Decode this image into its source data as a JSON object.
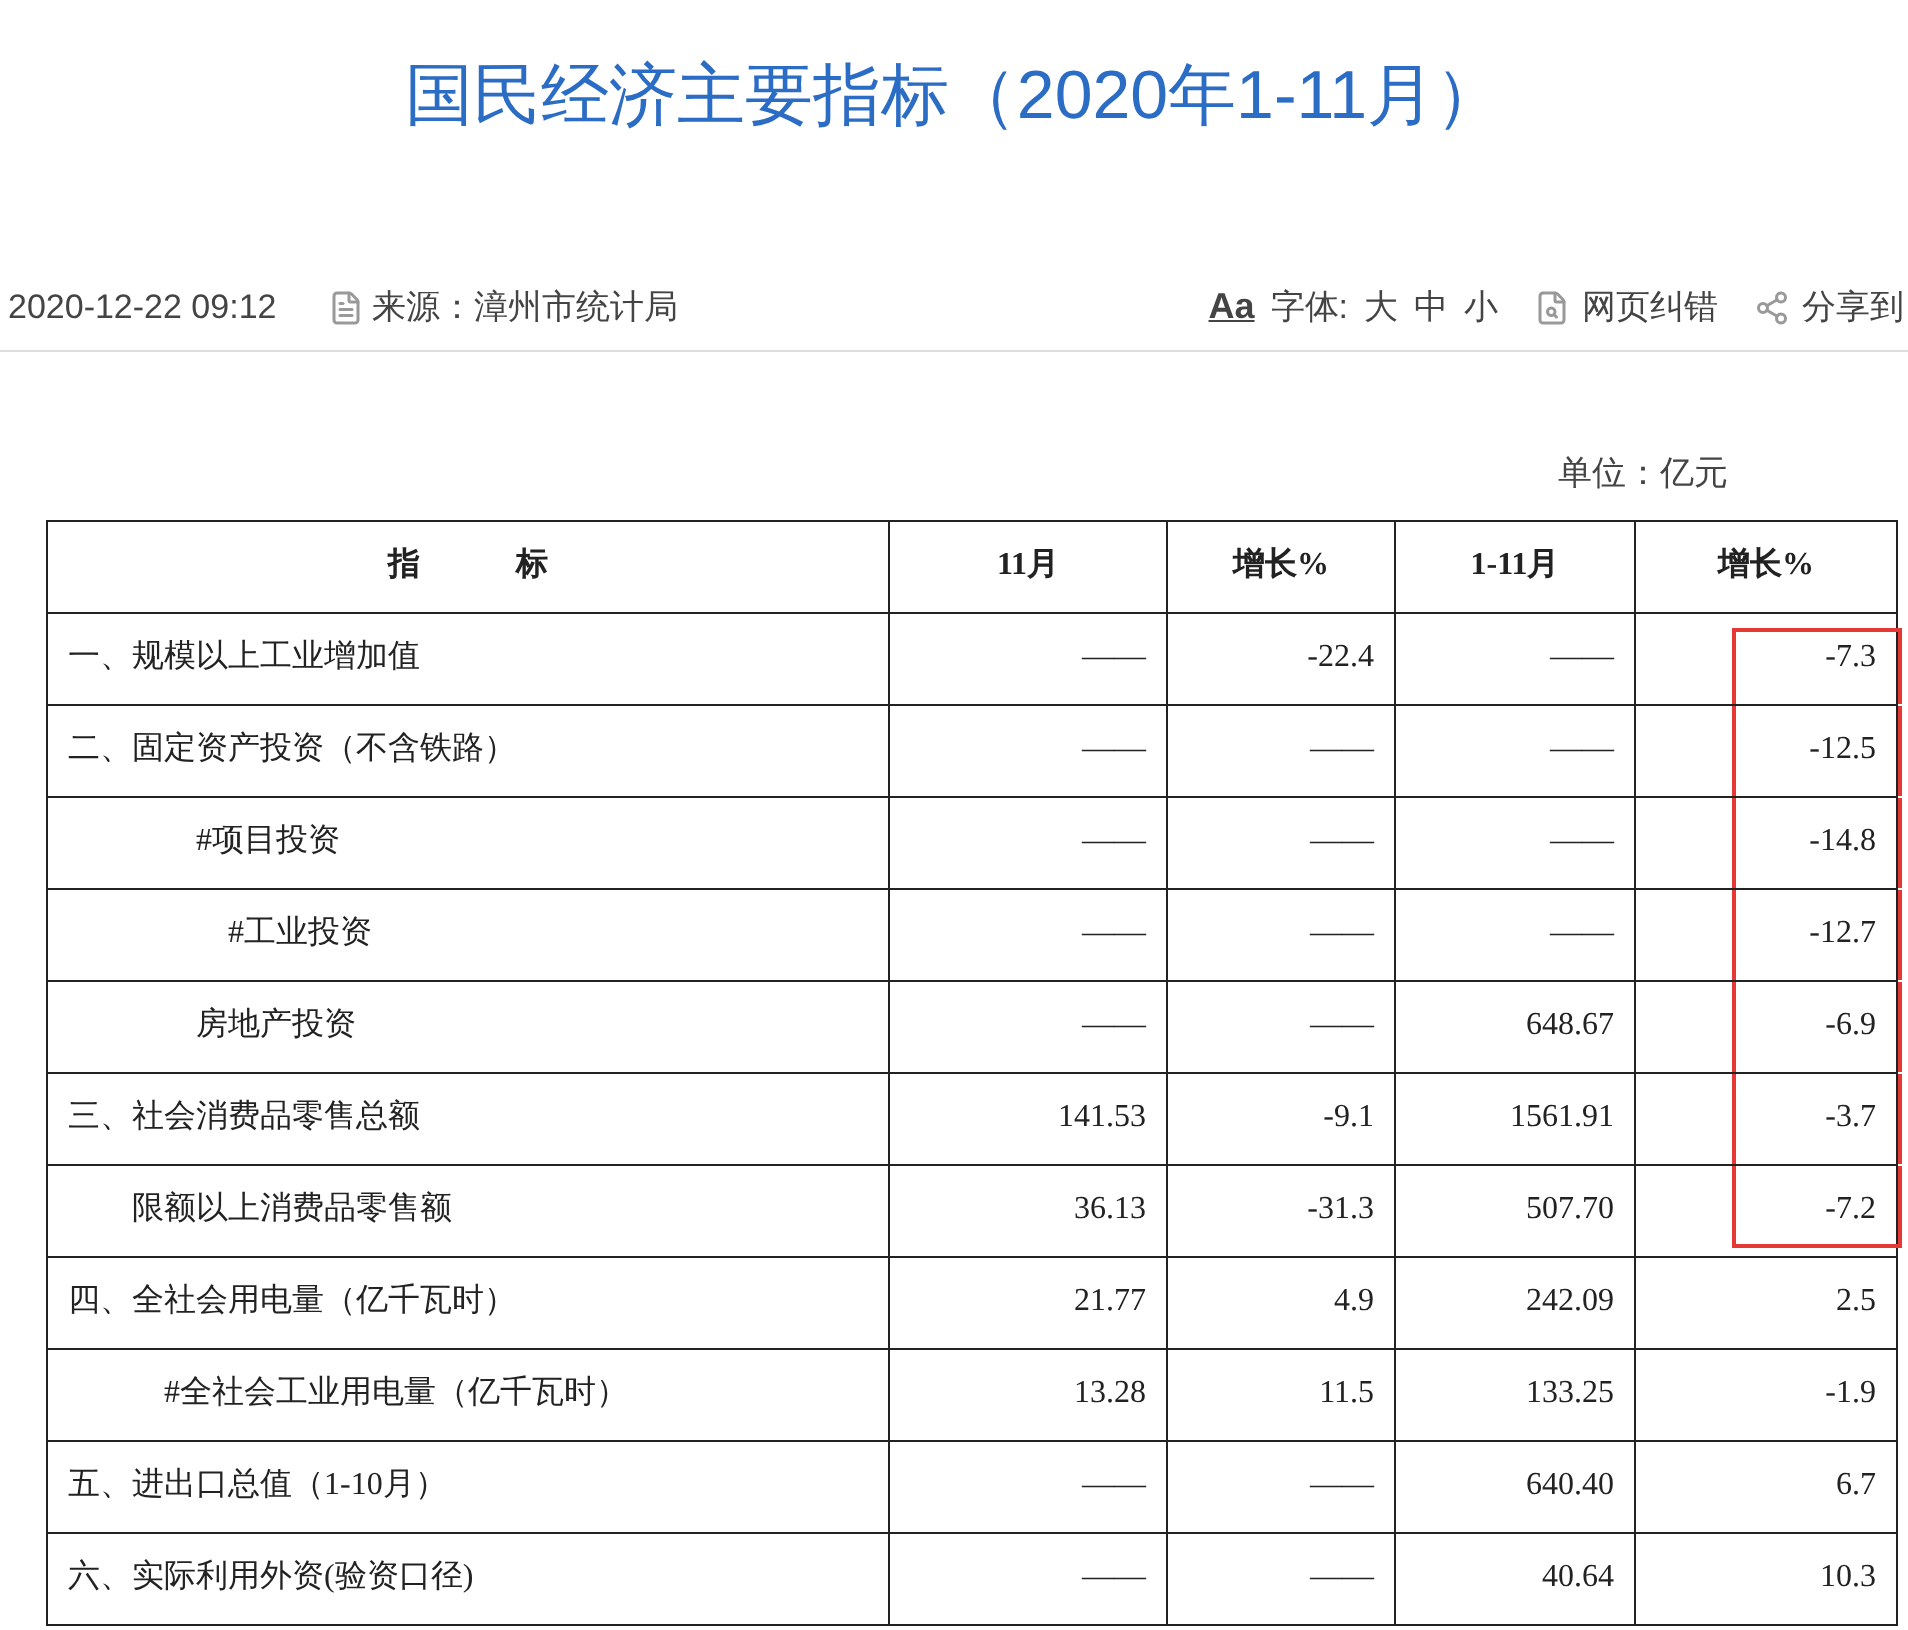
{
  "title": "国民经济主要指标（2020年1-11月）",
  "meta": {
    "datetime": "2020-12-22 09:12",
    "source": "来源：漳州市统计局",
    "font_icon": "Aa",
    "font_label": "字体:",
    "font_sizes": [
      "大",
      "中",
      "小"
    ],
    "report_error": "网页纠错",
    "share": "分享到"
  },
  "unit": "单位：亿元",
  "table": {
    "columns": [
      "指　　　标",
      "11月",
      "增长%",
      "1-11月",
      "增长%"
    ],
    "rows": [
      {
        "cells": [
          "一、规模以上工业增加值",
          "——",
          "-22.4",
          "——",
          "-7.3"
        ],
        "highlighted": true
      },
      {
        "cells": [
          "二、固定资产投资（不含铁路）",
          "——",
          "——",
          "——",
          "-12.5"
        ],
        "highlighted": true
      },
      {
        "cells": [
          "　　　　#项目投资",
          "——",
          "——",
          "——",
          "-14.8"
        ],
        "highlighted": true
      },
      {
        "cells": [
          "　　　　　#工业投资",
          "——",
          "——",
          "——",
          "-12.7"
        ],
        "highlighted": true
      },
      {
        "cells": [
          "　　　　房地产投资",
          "——",
          "——",
          "648.67",
          "-6.9"
        ],
        "highlighted": true
      },
      {
        "cells": [
          "三、社会消费品零售总额",
          "141.53",
          "-9.1",
          "1561.91",
          "-3.7"
        ],
        "highlighted": true
      },
      {
        "cells": [
          "　　限额以上消费品零售额",
          "36.13",
          "-31.3",
          "507.70",
          "-7.2"
        ],
        "highlighted": true
      },
      {
        "cells": [
          "四、全社会用电量（亿千瓦时）",
          "21.77",
          "4.9",
          "242.09",
          "2.5"
        ],
        "highlighted": false
      },
      {
        "cells": [
          "　　　#全社会工业用电量（亿千瓦时）",
          "13.28",
          "11.5",
          "133.25",
          "-1.9"
        ],
        "highlighted": false
      },
      {
        "cells": [
          "五、进出口总值（1-10月）",
          "——",
          "——",
          "640.40",
          "6.7"
        ],
        "highlighted": false
      },
      {
        "cells": [
          "六、实际利用外资(验资口径)",
          "——",
          "——",
          "40.64",
          "10.3"
        ],
        "highlighted": false
      }
    ]
  }
}
